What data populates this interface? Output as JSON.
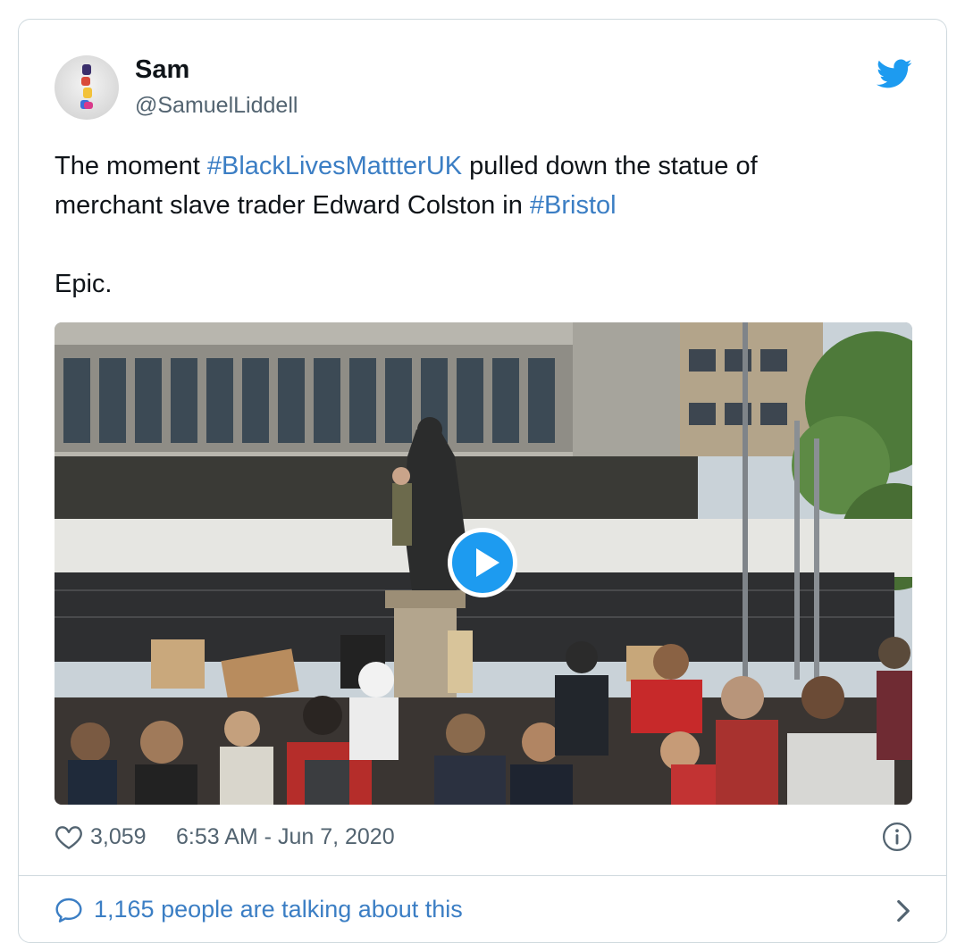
{
  "tweet": {
    "author": {
      "display_name": "Sam",
      "handle": "@SamuelLiddell"
    },
    "text": {
      "segments_line1": [
        {
          "text": "The moment ",
          "type": "plain"
        },
        {
          "text": "#BlackLivesMattterUK",
          "type": "hashtag"
        },
        {
          "text": " pulled down the statue of",
          "type": "plain"
        }
      ],
      "segments_line2": [
        {
          "text": "merchant slave trader Edward Colston in ",
          "type": "plain"
        },
        {
          "text": "#Bristol",
          "type": "hashtag"
        }
      ],
      "paragraph2": "Epic."
    },
    "media": {
      "type": "video",
      "icon": "play-icon"
    },
    "likes": "3,059",
    "timestamp": "6:53 AM - Jun 7, 2020",
    "talk_label": "1,165 people are talking about this"
  },
  "icons": {
    "brand": "twitter-bird-icon",
    "like": "heart-icon",
    "info": "info-icon",
    "reply": "speech-bubble-icon",
    "more": "chevron-right-icon"
  },
  "colors": {
    "brand_blue": "#1d9bf0",
    "link_blue": "#3b7ec4",
    "text_primary": "#0f1419",
    "text_secondary": "#536471",
    "border": "#cfd9de"
  }
}
